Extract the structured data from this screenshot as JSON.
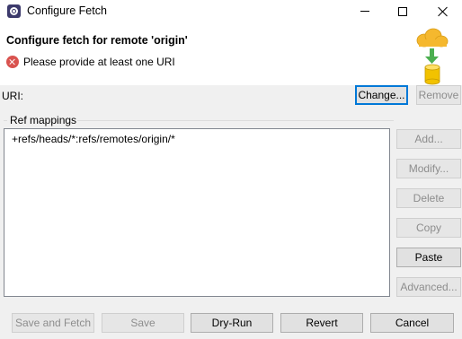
{
  "window": {
    "title": "Configure Fetch",
    "controls": [
      "minimize",
      "maximize",
      "close"
    ]
  },
  "header": {
    "title": "Configure fetch for remote 'origin'",
    "message": "Please provide at least one URI",
    "message_icon": "error-icon",
    "banner_icon": "cloud-fetch-database-icon"
  },
  "uri": {
    "label": "URI:",
    "change_label": "Change...",
    "remove_label": "Remove"
  },
  "ref_mappings": {
    "label": "Ref mappings",
    "items": [
      "+refs/heads/*:refs/remotes/origin/*"
    ],
    "buttons": {
      "add": "Add...",
      "modify": "Modify...",
      "delete": "Delete",
      "copy": "Copy",
      "paste": "Paste",
      "advanced": "Advanced..."
    }
  },
  "footer": {
    "save_and_fetch": "Save and Fetch",
    "save": "Save",
    "dry_run": "Dry-Run",
    "revert": "Revert",
    "cancel": "Cancel"
  },
  "colors": {
    "focus_border": "#0078d7",
    "error": "#d9534f",
    "cloud": "#f5b82e",
    "arrow": "#4caf50"
  }
}
